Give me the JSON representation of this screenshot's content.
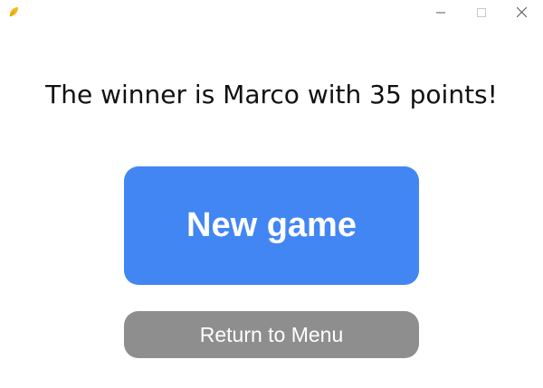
{
  "window": {
    "icon": "app-leaf-icon",
    "controls": [
      "minimize-icon",
      "maximize-icon",
      "close-icon"
    ]
  },
  "headline": "The winner is Marco with 35 points!",
  "buttons": {
    "new_game": "New game",
    "return_menu": "Return to Menu"
  },
  "colors": {
    "primary": "#4286f4",
    "secondary": "#8e8e8e",
    "icon": "#f5b81a"
  }
}
